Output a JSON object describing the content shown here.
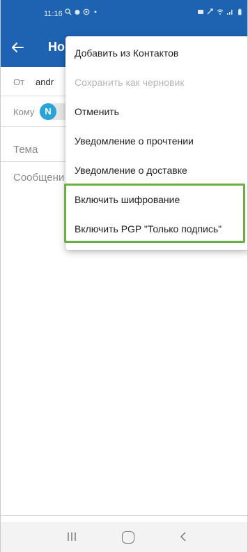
{
  "status_bar": {
    "time": "11:16"
  },
  "app_bar": {
    "title_visible": "Но"
  },
  "compose": {
    "from_label": "От",
    "from_value": "andr",
    "to_label": "Кому",
    "recipient_initial": "N",
    "subject_placeholder": "Тема",
    "message_placeholder": "Сообщени"
  },
  "menu": {
    "items": [
      {
        "label": "Добавить из Контактов",
        "enabled": true
      },
      {
        "label": "Сохранить как черновик",
        "enabled": false
      },
      {
        "label": "Отменить",
        "enabled": true
      },
      {
        "label": "Уведомление о прочтении",
        "enabled": true
      },
      {
        "label": "Уведомление о доставке",
        "enabled": true
      },
      {
        "label": "Включить шифрование",
        "enabled": true,
        "highlighted": true
      },
      {
        "label": "Включить PGP \"Только подпись\"",
        "enabled": true,
        "highlighted": true
      }
    ]
  },
  "colors": {
    "app_bar": "#1d63b1",
    "highlight": "#6cae45",
    "chip_avatar": "#29a3d8"
  },
  "icons": [
    "back-arrow-icon",
    "recent-apps-icon",
    "home-icon",
    "nav-back-icon",
    "wifi-icon",
    "signal-icon",
    "battery-icon",
    "search-icon",
    "alarm-icon",
    "mute-icon"
  ]
}
